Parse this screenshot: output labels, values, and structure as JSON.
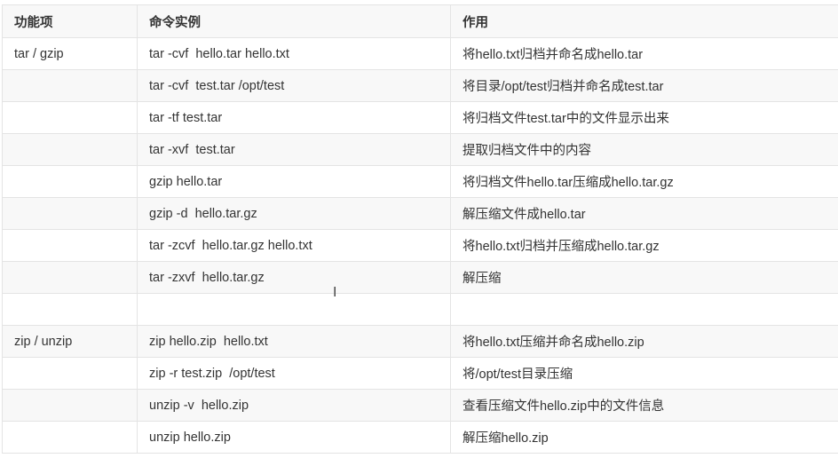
{
  "table": {
    "headers": [
      "功能项",
      "命令实例",
      "作用"
    ],
    "rows": [
      [
        "tar / gzip",
        "tar -cvf  hello.tar hello.txt",
        "将hello.txt归档并命名成hello.tar"
      ],
      [
        "",
        "tar -cvf  test.tar /opt/test",
        "将目录/opt/test归档并命名成test.tar"
      ],
      [
        "",
        "tar -tf test.tar",
        "将归档文件test.tar中的文件显示出来"
      ],
      [
        "",
        "tar -xvf  test.tar",
        "提取归档文件中的内容"
      ],
      [
        "",
        "gzip hello.tar",
        "将归档文件hello.tar压缩成hello.tar.gz"
      ],
      [
        "",
        "gzip -d  hello.tar.gz",
        "解压缩文件成hello.tar"
      ],
      [
        "",
        "tar -zcvf  hello.tar.gz hello.txt",
        "将hello.txt归档并压缩成hello.tar.gz"
      ],
      [
        "",
        "tar -zxvf  hello.tar.gz",
        "解压缩"
      ],
      [
        "",
        "",
        ""
      ],
      [
        "zip / unzip",
        "zip hello.zip  hello.txt",
        "将hello.txt压缩并命名成hello.zip"
      ],
      [
        "",
        "zip -r test.zip  /opt/test",
        "将/opt/test目录压缩"
      ],
      [
        "",
        "unzip -v  hello.zip",
        "查看压缩文件hello.zip中的文件信息"
      ],
      [
        "",
        "unzip hello.zip",
        "解压缩hello.zip"
      ]
    ]
  },
  "cursor": {
    "icon": "text-cursor-icon",
    "glyph": "I"
  }
}
